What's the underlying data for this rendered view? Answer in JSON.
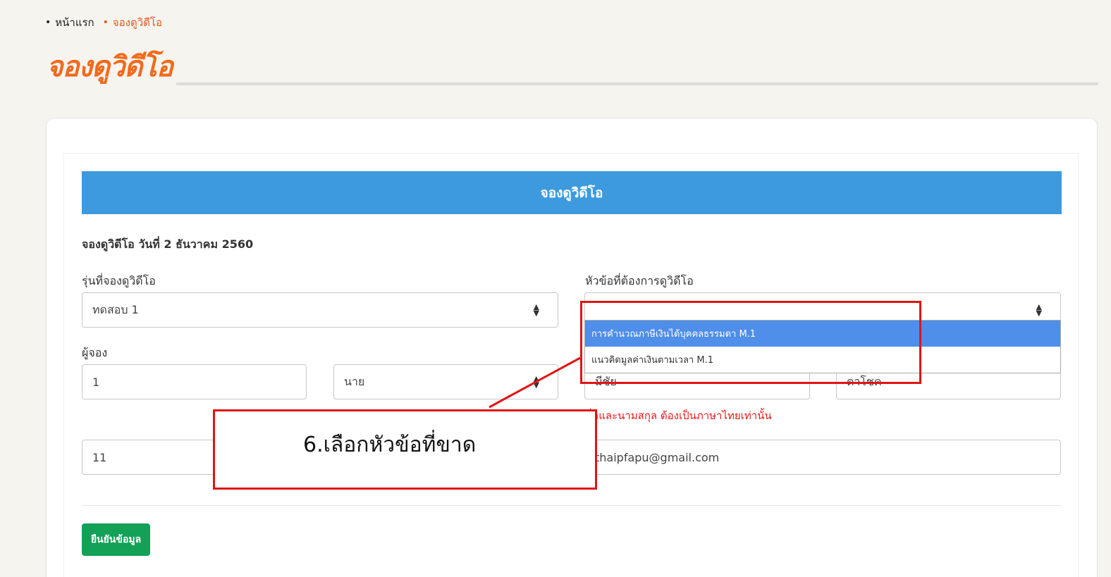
{
  "breadcrumb": {
    "home": "หน้าแรก",
    "current": "จองดูวิดีโอ"
  },
  "page_title": "จองดูวิดีโอ",
  "form": {
    "header": "จองดูวิดีโอ",
    "subtitle": "จองดูวิดีโอ วันที่ 2 ธันวาคม 2560",
    "batch_label": "รุ่นที่จองดูวิดีโอ",
    "batch_value": "ทดสอบ 1",
    "topic_label": "หัวข้อที่ต้องการดูวิดีโอ",
    "topic_value": "",
    "booker_label": "ผู้จอง",
    "booker_id": "1",
    "prefix_value": "นาย",
    "first_name": "มีชัย",
    "last_name": "ตาโชค",
    "name_hint": "ชื่อและนามสกุล ต้องเป็นภาษาไทยเท่านั้น",
    "phone": "11",
    "email": "thaipfapu@gmail.com",
    "confirm_label": "ยืนยันข้อมูล"
  },
  "topic_dropdown": {
    "options": [
      "การคำนวณภาษีเงินได้บุคคลธรรมดา M.1",
      "แนวคิดมูลค่าเงินตามเวลา M.1"
    ],
    "selected_index": 0
  },
  "annotation": {
    "text": "6.เลือกหัวข้อที่ขาด",
    "color": "#e01414"
  },
  "colors": {
    "accent": "#f26a1b",
    "header": "#3d9ade",
    "confirm": "#12a156",
    "highlight": "#4f8ee9"
  }
}
